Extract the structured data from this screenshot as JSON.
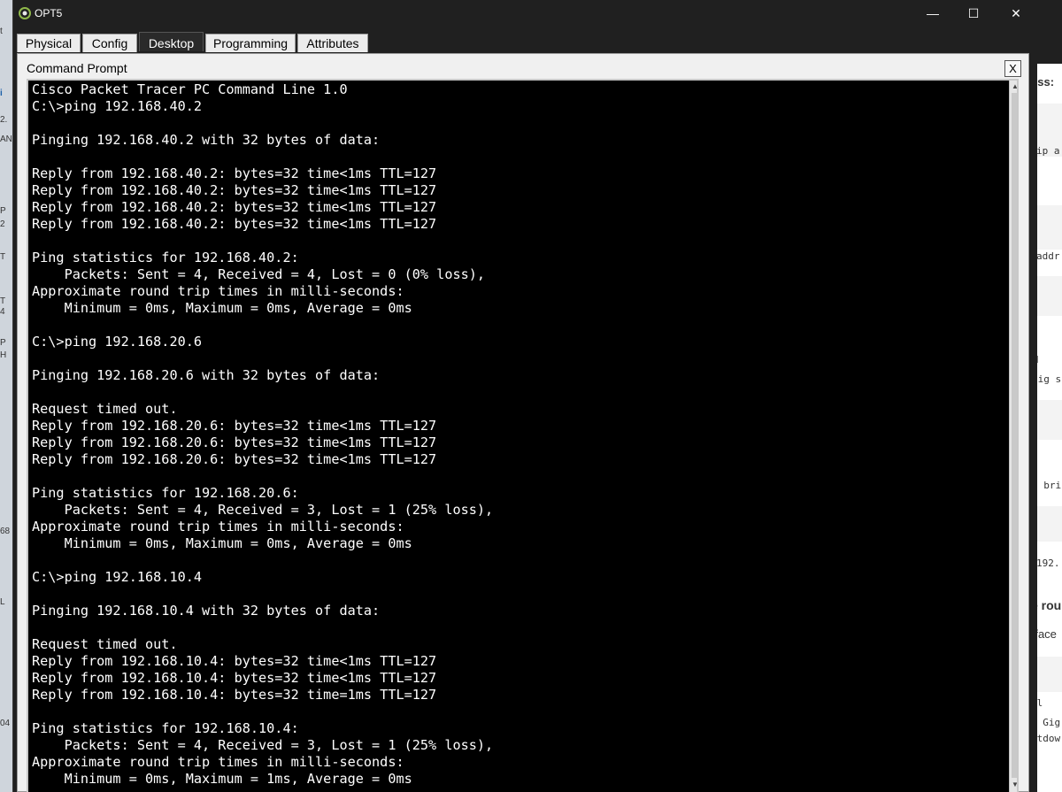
{
  "window": {
    "title": "OPT5",
    "minimize_label": "—",
    "maximize_label": "☐",
    "close_label": "✕"
  },
  "tabs": [
    {
      "label": "Physical"
    },
    {
      "label": "Config"
    },
    {
      "label": "Desktop"
    },
    {
      "label": "Programming"
    },
    {
      "label": "Attributes"
    }
  ],
  "active_tab": "Desktop",
  "panel": {
    "title": "Command Prompt",
    "close_label": "X"
  },
  "console_lines": [
    "Cisco Packet Tracer PC Command Line 1.0",
    "C:\\>ping 192.168.40.2",
    "",
    "Pinging 192.168.40.2 with 32 bytes of data:",
    "",
    "Reply from 192.168.40.2: bytes=32 time<1ms TTL=127",
    "Reply from 192.168.40.2: bytes=32 time<1ms TTL=127",
    "Reply from 192.168.40.2: bytes=32 time<1ms TTL=127",
    "Reply from 192.168.40.2: bytes=32 time<1ms TTL=127",
    "",
    "Ping statistics for 192.168.40.2:",
    "    Packets: Sent = 4, Received = 4, Lost = 0 (0% loss),",
    "Approximate round trip times in milli-seconds:",
    "    Minimum = 0ms, Maximum = 0ms, Average = 0ms",
    "",
    "C:\\>ping 192.168.20.6",
    "",
    "Pinging 192.168.20.6 with 32 bytes of data:",
    "",
    "Request timed out.",
    "Reply from 192.168.20.6: bytes=32 time<1ms TTL=127",
    "Reply from 192.168.20.6: bytes=32 time<1ms TTL=127",
    "Reply from 192.168.20.6: bytes=32 time<1ms TTL=127",
    "",
    "Ping statistics for 192.168.20.6:",
    "    Packets: Sent = 4, Received = 3, Lost = 1 (25% loss),",
    "Approximate round trip times in milli-seconds:",
    "    Minimum = 0ms, Maximum = 0ms, Average = 0ms",
    "",
    "C:\\>ping 192.168.10.4",
    "",
    "Pinging 192.168.10.4 with 32 bytes of data:",
    "",
    "Request timed out.",
    "Reply from 192.168.10.4: bytes=32 time<1ms TTL=127",
    "Reply from 192.168.10.4: bytes=32 time<1ms TTL=127",
    "Reply from 192.168.10.4: bytes=32 time=1ms TTL=127",
    "",
    "Ping statistics for 192.168.10.4:",
    "    Packets: Sent = 4, Received = 3, Lost = 1 (25% loss),",
    "Approximate round trip times in milli-seconds:",
    "    Minimum = 0ms, Maximum = 1ms, Average = 0ms"
  ],
  "background_fragments": {
    "left": [
      "t",
      "i",
      "2.",
      "AN",
      "P",
      "2",
      "T",
      "T",
      "4",
      "P",
      "H",
      "68",
      "L",
      "04"
    ],
    "right": [
      "ess:",
      "ip a",
      "addr",
      "d",
      "fig s",
      "e bri",
      "192.",
      "e rou",
      "rface",
      "al",
      "e Gig",
      "utdow"
    ]
  },
  "colors": {
    "console_bg": "#000000",
    "console_text": "#ffffff",
    "window_bg": "#202020",
    "panel_bg": "#f0f0f0"
  }
}
